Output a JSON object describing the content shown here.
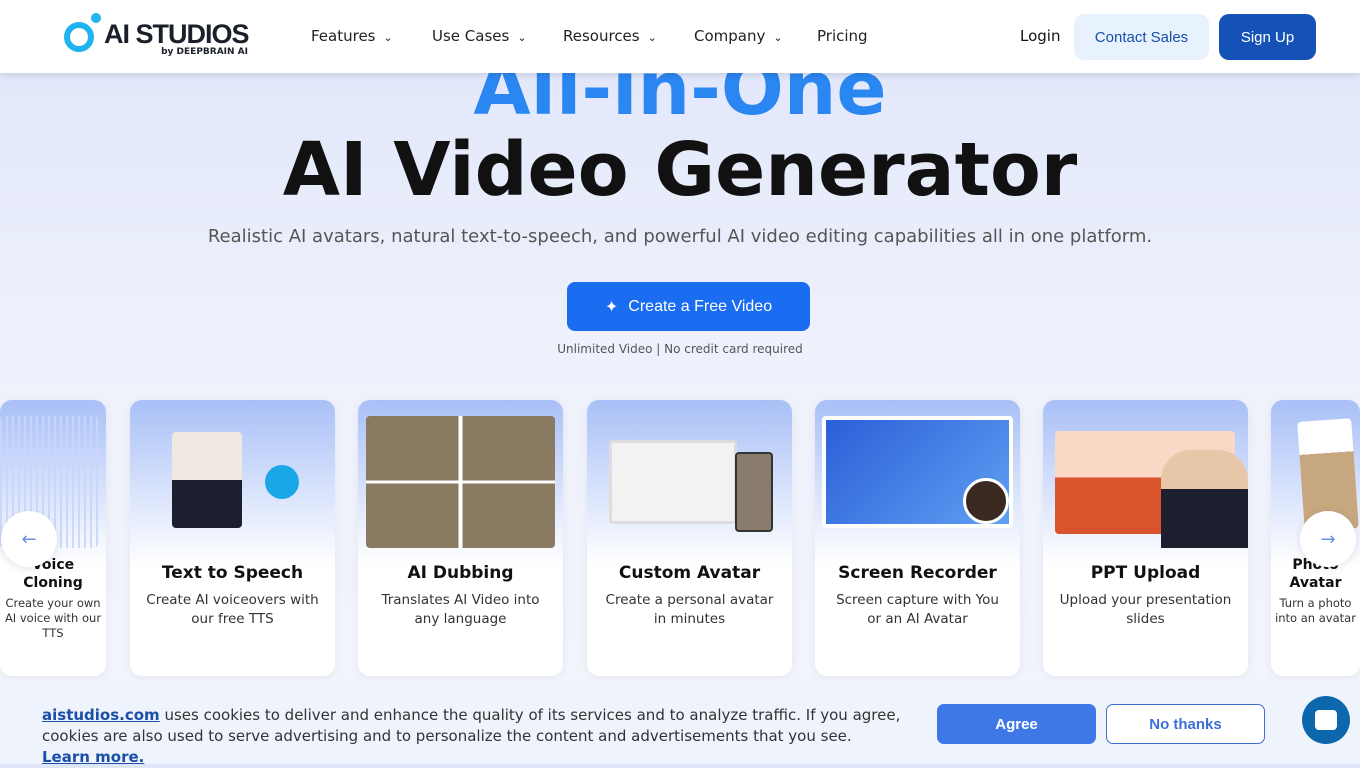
{
  "header": {
    "logo_text": "AI STUDIOS",
    "logo_sub": "by DEEPBRAIN AI",
    "nav": [
      {
        "label": "Features"
      },
      {
        "label": "Use Cases"
      },
      {
        "label": "Resources"
      },
      {
        "label": "Company"
      },
      {
        "label": "Pricing"
      }
    ],
    "login": "Login",
    "contact_sales": "Contact Sales",
    "sign_up": "Sign Up"
  },
  "hero": {
    "title_line1": "All-in-One",
    "title_line2": "AI Video Generator",
    "subtitle": "Realistic AI avatars, natural text-to-speech, and powerful AI video editing capabilities all in one platform.",
    "cta": "Create a Free Video",
    "note": "Unlimited Video | No credit card required"
  },
  "cards": [
    {
      "title": "Voice Cloning",
      "desc": "Create your own AI voice with our TTS"
    },
    {
      "title": "Text to Speech",
      "desc": "Create AI voiceovers with our free TTS"
    },
    {
      "title": "AI Dubbing",
      "desc": "Translates AI Video into any language"
    },
    {
      "title": "Custom Avatar",
      "desc": "Create a personal avatar in minutes"
    },
    {
      "title": "Screen Recorder",
      "desc": "Screen capture with You or an AI Avatar"
    },
    {
      "title": "PPT Upload",
      "desc": "Upload your presentation slides"
    },
    {
      "title": "Photo Avatar",
      "desc": "Turn a photo into an avatar"
    }
  ],
  "cookie": {
    "site": "aistudios.com",
    "text": " uses cookies to deliver and enhance the quality of its services and to analyze traffic. If you agree, cookies are also used to serve advertising and to personalize the content and advertisements that you see. ",
    "learn_more": "Learn more.",
    "agree": "Agree",
    "no_thanks": "No thanks"
  },
  "colors": {
    "accent": "#2a86f1",
    "primary_button": "#1a6cf0",
    "sign_up": "#1552b8",
    "agree": "#3e77e6"
  }
}
